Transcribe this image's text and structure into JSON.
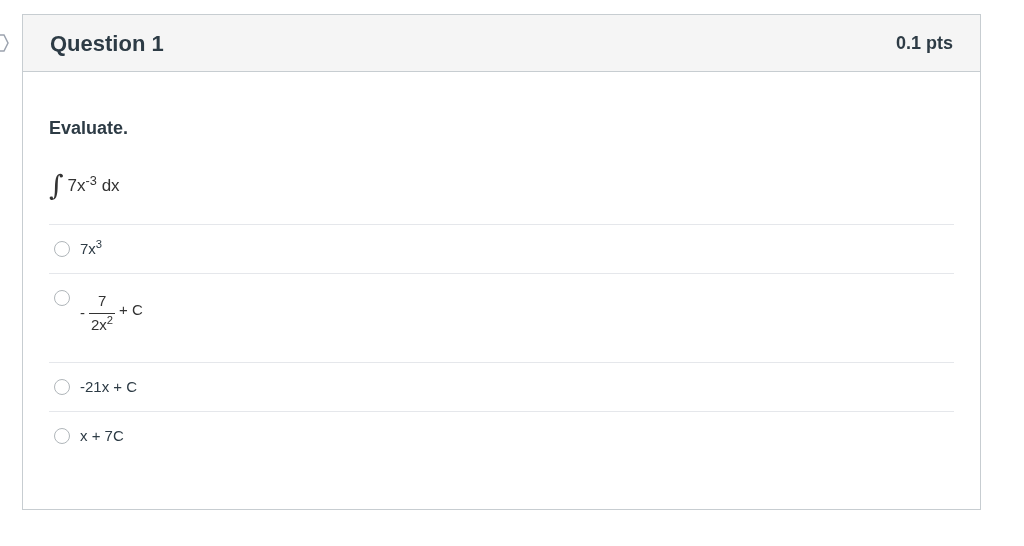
{
  "question": {
    "title": "Question 1",
    "points": "0.1 pts",
    "prompt": "Evaluate.",
    "integral_sign": "∫",
    "integrand": "7x$^{-3}$ dx"
  },
  "answers": [
    {
      "kind": "text",
      "text": "7x$^{3}$",
      "selected": false
    },
    {
      "kind": "fraction",
      "sign": "-",
      "numerator": "7",
      "denominator": "2x$^{2}$",
      "suffix": "+ C",
      "selected": false
    },
    {
      "kind": "text",
      "text": "-21x + C",
      "selected": false
    },
    {
      "kind": "text",
      "text": "x + 7C",
      "selected": false
    }
  ]
}
